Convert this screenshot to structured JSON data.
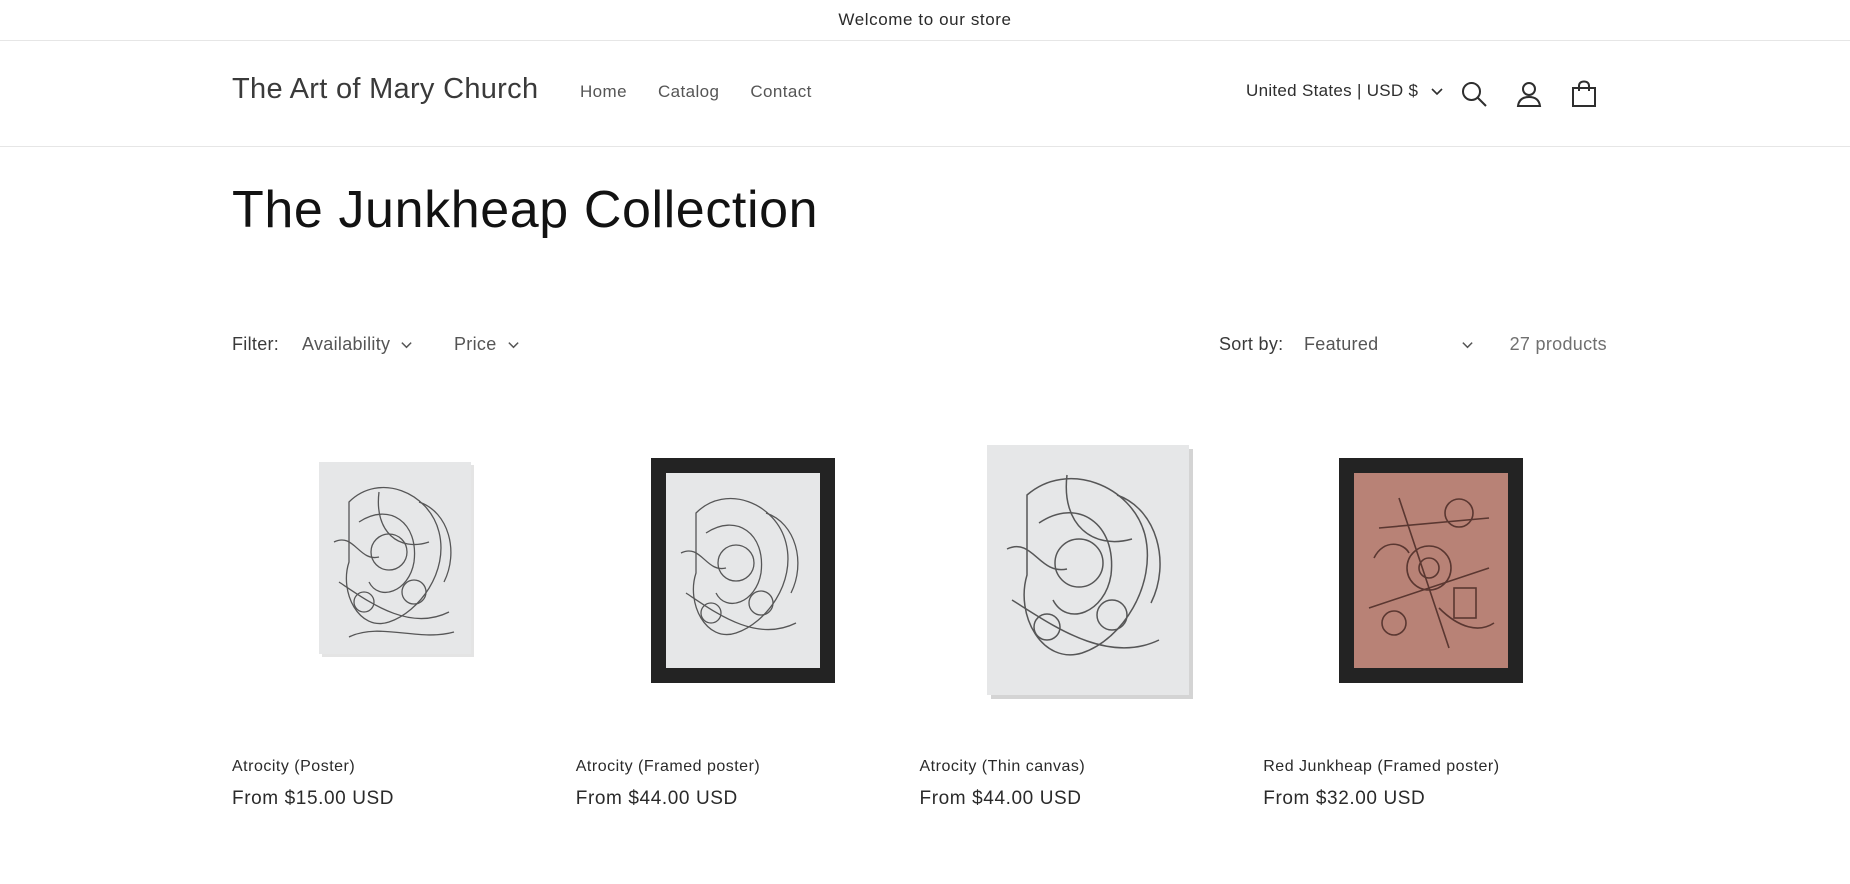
{
  "announcement": "Welcome to our store",
  "header": {
    "logo": "The Art of Mary Church",
    "nav": [
      "Home",
      "Catalog",
      "Contact"
    ],
    "country": "United States | USD $",
    "icons": [
      "search-icon",
      "account-icon",
      "cart-icon"
    ]
  },
  "collection": {
    "title": "The Junkheap Collection",
    "filter_label": "Filter:",
    "filters": [
      "Availability",
      "Price"
    ],
    "sort_label": "Sort by:",
    "sort_value": "Featured",
    "count": "27 products"
  },
  "products": [
    {
      "title": "Atrocity (Poster)",
      "price": "From $15.00 USD"
    },
    {
      "title": "Atrocity (Framed poster)",
      "price": "From $44.00 USD"
    },
    {
      "title": "Atrocity (Thin canvas)",
      "price": "From $44.00 USD"
    },
    {
      "title": "Red Junkheap (Framed poster)",
      "price": "From $32.00 USD"
    }
  ],
  "colors": {
    "text": "#121212",
    "muted": "#707070",
    "border": "#e6e6e6",
    "frame": "#232323",
    "red_art": "#b88276"
  }
}
